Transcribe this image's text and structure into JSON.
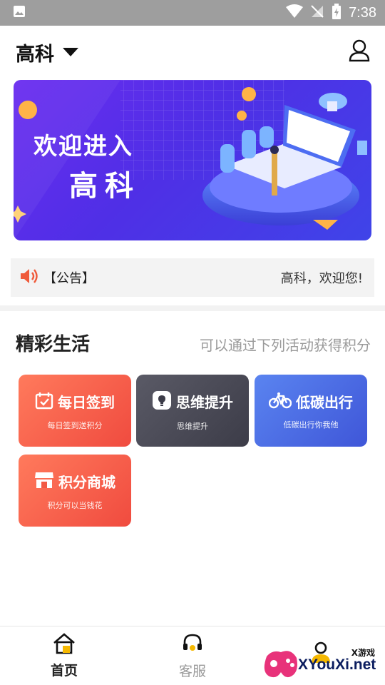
{
  "status_bar": {
    "time": "7:38"
  },
  "header": {
    "city": "高科"
  },
  "banner": {
    "line1": "欢迎进入",
    "line2": "高科"
  },
  "notice": {
    "label": "【公告】",
    "text": "高科，欢迎您!"
  },
  "section": {
    "title": "精彩生活",
    "subtitle": "可以通过下列活动获得积分"
  },
  "cards": [
    {
      "title": "每日签到",
      "sub": "每日签到送积分",
      "icon": "calendar-check-icon"
    },
    {
      "title": "思维提升",
      "sub": "思维提升",
      "icon": "lightbulb-icon"
    },
    {
      "title": "低碳出行",
      "sub": "低碳出行你我他",
      "icon": "bicycle-icon"
    },
    {
      "title": "积分商城",
      "sub": "积分可以当钱花",
      "icon": "store-icon"
    }
  ],
  "tabs": [
    {
      "label": "首页",
      "icon": "home-icon"
    },
    {
      "label": "客服",
      "icon": "headset-icon"
    },
    {
      "label": "",
      "icon": "person-icon"
    }
  ],
  "watermark": {
    "small": "X游戏",
    "big": "XYouXi.net"
  },
  "colors": {
    "accent_orange": "#f04b3f",
    "banner_purple": "#5b2ee8",
    "dark_card": "#3c3c48",
    "blue_card": "#3f56d8"
  }
}
